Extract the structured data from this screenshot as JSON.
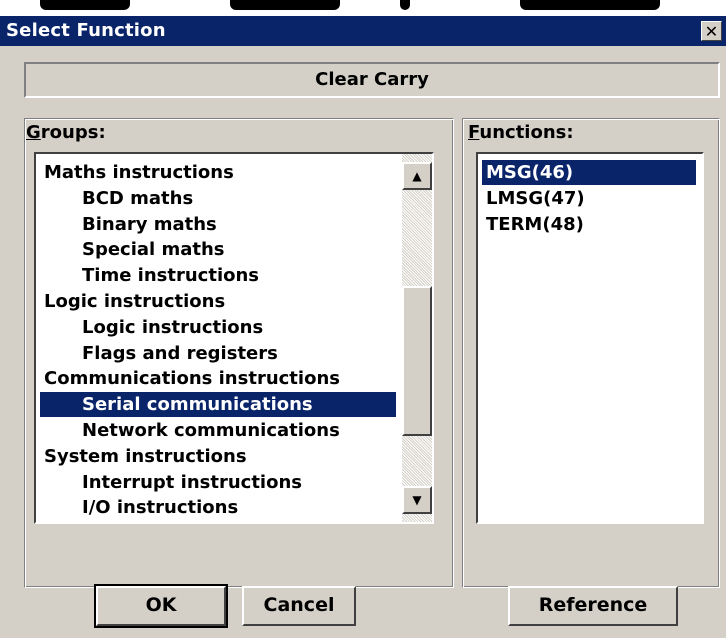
{
  "window": {
    "title": "Select Function",
    "close_glyph": "✕"
  },
  "description": "Clear Carry",
  "groups": {
    "label_accel": "G",
    "label_rest": "roups:",
    "items": [
      {
        "label": "Maths instructions",
        "indent": 0,
        "selected": false
      },
      {
        "label": "BCD maths",
        "indent": 1,
        "selected": false
      },
      {
        "label": "Binary maths",
        "indent": 1,
        "selected": false
      },
      {
        "label": "Special maths",
        "indent": 1,
        "selected": false
      },
      {
        "label": "Time instructions",
        "indent": 1,
        "selected": false
      },
      {
        "label": "Logic instructions",
        "indent": 0,
        "selected": false
      },
      {
        "label": "Logic instructions",
        "indent": 1,
        "selected": false
      },
      {
        "label": "Flags and registers",
        "indent": 1,
        "selected": false
      },
      {
        "label": "Communications instructions",
        "indent": 0,
        "selected": false
      },
      {
        "label": "Serial communications",
        "indent": 1,
        "selected": true
      },
      {
        "label": "Network communications",
        "indent": 1,
        "selected": false
      },
      {
        "label": "System instructions",
        "indent": 0,
        "selected": false
      },
      {
        "label": "Interrupt instructions",
        "indent": 1,
        "selected": false
      },
      {
        "label": "I/O instructions",
        "indent": 1,
        "selected": false
      }
    ],
    "scroll_up_glyph": "▲",
    "scroll_down_glyph": "▼"
  },
  "functions": {
    "label_accel": "F",
    "label_rest": "unctions:",
    "items": [
      {
        "label": "MSG(46)",
        "selected": true
      },
      {
        "label": "LMSG(47)",
        "selected": false
      },
      {
        "label": "TERM(48)",
        "selected": false
      }
    ]
  },
  "buttons": {
    "ok": "OK",
    "cancel": "Cancel",
    "reference": "Reference"
  }
}
